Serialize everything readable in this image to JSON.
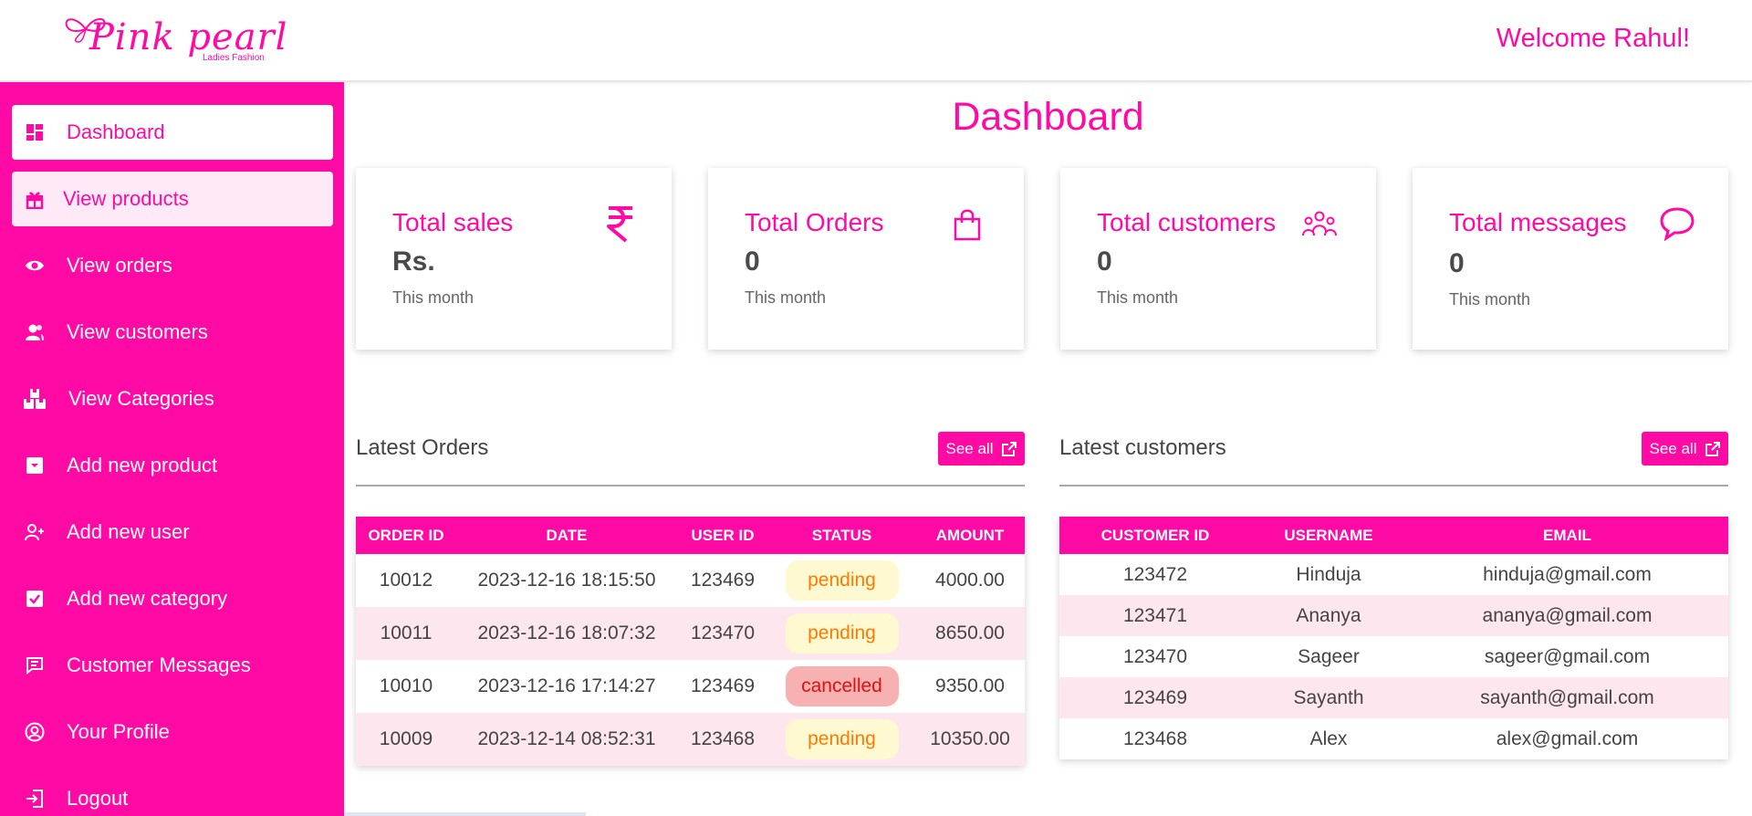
{
  "brand": {
    "name": "Pink pearl",
    "tagline": "Ladies Fashion",
    "accent": "#ff0aa5"
  },
  "header": {
    "welcome": "Welcome Rahul!"
  },
  "sidebar": {
    "items": [
      {
        "label": "Dashboard",
        "icon": "dashboard-icon",
        "state": "active"
      },
      {
        "label": "View products",
        "icon": "gift-icon",
        "state": "hover"
      },
      {
        "label": "View orders",
        "icon": "eye-icon"
      },
      {
        "label": "View customers",
        "icon": "users-icon"
      },
      {
        "label": "View Categories",
        "icon": "boxes-icon"
      },
      {
        "label": "Add new product",
        "icon": "add-box-icon"
      },
      {
        "label": "Add new user",
        "icon": "user-plus-icon"
      },
      {
        "label": "Add new category",
        "icon": "check-box-icon"
      },
      {
        "label": "Customer Messages",
        "icon": "message-icon"
      },
      {
        "label": "Your Profile",
        "icon": "profile-icon"
      },
      {
        "label": "Logout",
        "icon": "logout-icon"
      }
    ]
  },
  "main": {
    "title": "Dashboard",
    "cards": [
      {
        "title": "Total sales",
        "value": "Rs.",
        "sub": "This month",
        "icon": "rupee-icon"
      },
      {
        "title": "Total Orders",
        "value": "0",
        "sub": "This month",
        "icon": "shopping-bag-icon"
      },
      {
        "title": "Total customers",
        "value": "0",
        "sub": "This month",
        "icon": "group-icon"
      },
      {
        "title": "Total messages",
        "value": "0",
        "sub": "This month",
        "icon": "chat-bubble-icon"
      }
    ],
    "orders": {
      "title": "Latest Orders",
      "see_all": "See all",
      "columns": [
        "ORDER ID",
        "DATE",
        "USER ID",
        "STATUS",
        "AMOUNT"
      ],
      "rows": [
        [
          "10012",
          "2023-12-16 18:15:50",
          "123469",
          "pending",
          "4000.00"
        ],
        [
          "10011",
          "2023-12-16 18:07:32",
          "123470",
          "pending",
          "8650.00"
        ],
        [
          "10010",
          "2023-12-16 17:14:27",
          "123469",
          "cancelled",
          "9350.00"
        ],
        [
          "10009",
          "2023-12-14 08:52:31",
          "123468",
          "pending",
          "10350.00"
        ]
      ]
    },
    "customers": {
      "title": "Latest customers",
      "see_all": "See all",
      "columns": [
        "CUSTOMER ID",
        "USERNAME",
        "EMAIL"
      ],
      "rows": [
        [
          "123472",
          "Hinduja",
          "hinduja@gmail.com"
        ],
        [
          "123471",
          "Ananya",
          "ananya@gmail.com"
        ],
        [
          "123470",
          "Sageer",
          "sageer@gmail.com"
        ],
        [
          "123469",
          "Sayanth",
          "sayanth@gmail.com"
        ],
        [
          "123468",
          "Alex",
          "alex@gmail.com"
        ]
      ]
    }
  }
}
